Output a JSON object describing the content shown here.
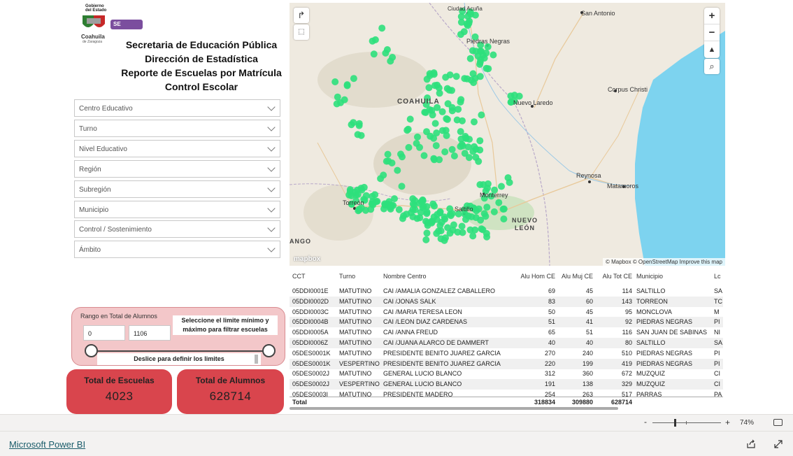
{
  "logo": {
    "line1": "Gobierno",
    "line2": "del Estado",
    "brand": "Coahuila",
    "sub": "de Zaragoza",
    "badge": "SE"
  },
  "titles": [
    "Secretaria de Educación Pública",
    "Dirección de Estadística",
    "Reporte de Escuelas por Matrícula",
    "Control Escolar"
  ],
  "filters": [
    "Centro Educativo",
    "Turno",
    "Nivel Educativo",
    "Región",
    "Subregión",
    "Municipio",
    "Control / Sostenimiento",
    "Ámbito"
  ],
  "map": {
    "labels": {
      "ciudad_acuna": "Ciudad Acuña",
      "san_antonio": "San Antonio",
      "piedras_negras": "Piedras Negras",
      "coahuila": "COAHUILA",
      "nuevo_laredo": "Nuevo Laredo",
      "corpus_christi": "Corpus Christi",
      "reynosa": "Reynosa",
      "matamoros": "Matamoros",
      "monterrey": "Monterrey",
      "torreon": "Torreón",
      "saltillo": "Saltillo",
      "nuevo_leon_1": "NUEVO",
      "nuevo_leon_2": "LEÓN",
      "ango": "ANGO"
    },
    "attribution": "© Mapbox © OpenStreetMap Improve this map",
    "logo": "mapbox",
    "point_color": "#2ee07c"
  },
  "table": {
    "headers": [
      "CCT",
      "Turno",
      "Nombre Centro",
      "Alu Hom CE",
      "Alu Muj CE",
      "Alu Tot CE",
      "Municipio",
      "Lc"
    ],
    "rows": [
      [
        "05DDI0001E",
        "MATUTINO",
        "CAI /AMALIA GONZALEZ CABALLERO",
        "69",
        "45",
        "114",
        "SALTILLO",
        "SA"
      ],
      [
        "05DDI0002D",
        "MATUTINO",
        "CAI /JONAS SALK",
        "83",
        "60",
        "143",
        "TORREON",
        "TC"
      ],
      [
        "05DDI0003C",
        "MATUTINO",
        "CAI /MARIA TERESA LEON",
        "50",
        "45",
        "95",
        "MONCLOVA",
        "M"
      ],
      [
        "05DDI0004B",
        "MATUTINO",
        "CAI /LEON DIAZ CARDENAS",
        "51",
        "41",
        "92",
        "PIEDRAS NEGRAS",
        "PI"
      ],
      [
        "05DDI0005A",
        "MATUTINO",
        "CAI /ANNA FREUD",
        "65",
        "51",
        "116",
        "SAN JUAN DE SABINAS",
        "NI"
      ],
      [
        "05DDI0006Z",
        "MATUTINO",
        "CAI /JUANA ALARCO DE DAMMERT",
        "40",
        "40",
        "80",
        "SALTILLO",
        "SA"
      ],
      [
        "05DES0001K",
        "MATUTINO",
        "PRESIDENTE BENITO JUAREZ GARCIA",
        "270",
        "240",
        "510",
        "PIEDRAS NEGRAS",
        "PI"
      ],
      [
        "05DES0001K",
        "VESPERTINO",
        "PRESIDENTE BENITO JUAREZ GARCIA",
        "220",
        "199",
        "419",
        "PIEDRAS NEGRAS",
        "PI"
      ],
      [
        "05DES0002J",
        "MATUTINO",
        "GENERAL LUCIO BLANCO",
        "312",
        "360",
        "672",
        "MUZQUIZ",
        "CI"
      ],
      [
        "05DES0002J",
        "VESPERTINO",
        "GENERAL LUCIO BLANCO",
        "191",
        "138",
        "329",
        "MUZQUIZ",
        "CI"
      ],
      [
        "05DES0003I",
        "MATUTINO",
        "PRESIDENTE MADERO",
        "254",
        "263",
        "517",
        "PARRAS",
        "PA"
      ]
    ],
    "total": {
      "label": "Total",
      "hom": "318834",
      "muj": "309880",
      "tot": "628714"
    }
  },
  "slicer": {
    "title": "Rango en Total de Alumnos",
    "min": "0",
    "max": "1106",
    "note": "Seleccione el limite mínimo y máximo para filtrar escuelas",
    "hint": "Deslice para definir los limites"
  },
  "cards": {
    "escuelas": {
      "label": "Total de Escuelas",
      "value": "4023"
    },
    "alumnos": {
      "label": "Total de Alumnos",
      "value": "628714"
    }
  },
  "colors": {
    "card": "#d9454d",
    "slicer_bg": "#f3c7c9",
    "map_water": "#7dd3ef",
    "map_land": "#efeae0"
  },
  "zoom": {
    "minus": "-",
    "plus": "+",
    "level": "74%"
  },
  "footer": {
    "link": "Microsoft Power BI"
  },
  "icons": [
    "share-icon",
    "fullscreen-icon",
    "fit-page-icon"
  ]
}
